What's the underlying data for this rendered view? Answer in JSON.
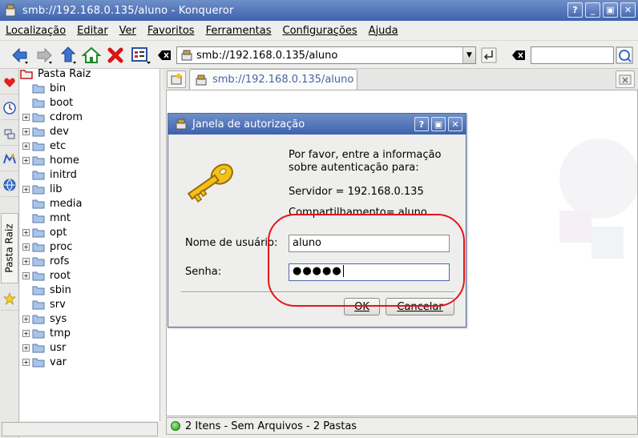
{
  "window": {
    "title": "smb://192.168.0.135/aluno - Konqueror",
    "buttons": [
      "?",
      "_",
      "▣",
      "✕"
    ]
  },
  "menu": {
    "items": [
      {
        "label": "Localização"
      },
      {
        "label": "Editar"
      },
      {
        "label": "Ver"
      },
      {
        "label": "Favoritos"
      },
      {
        "label": "Ferramentas"
      },
      {
        "label": "Configurações"
      },
      {
        "label": "Ajuda"
      }
    ]
  },
  "toolbar": {
    "url": "smb://192.168.0.135/aluno",
    "search_value": ""
  },
  "sidetabs": {
    "label": "Pasta Raiz"
  },
  "tree": {
    "root": "Pasta Raiz",
    "items": [
      {
        "label": "bin",
        "expandable": false
      },
      {
        "label": "boot",
        "expandable": false
      },
      {
        "label": "cdrom",
        "expandable": true
      },
      {
        "label": "dev",
        "expandable": true
      },
      {
        "label": "etc",
        "expandable": true
      },
      {
        "label": "home",
        "expandable": true
      },
      {
        "label": "initrd",
        "expandable": false
      },
      {
        "label": "lib",
        "expandable": true
      },
      {
        "label": "media",
        "expandable": false
      },
      {
        "label": "mnt",
        "expandable": false
      },
      {
        "label": "opt",
        "expandable": true
      },
      {
        "label": "proc",
        "expandable": true
      },
      {
        "label": "rofs",
        "expandable": true
      },
      {
        "label": "root",
        "expandable": true
      },
      {
        "label": "sbin",
        "expandable": false
      },
      {
        "label": "srv",
        "expandable": false
      },
      {
        "label": "sys",
        "expandable": true
      },
      {
        "label": "tmp",
        "expandable": true
      },
      {
        "label": "usr",
        "expandable": true
      },
      {
        "label": "var",
        "expandable": true
      }
    ]
  },
  "main": {
    "tab_label": "smb://192.168.0.135/aluno",
    "status": "2 Itens - Sem Arquivos - 2 Pastas"
  },
  "dialog": {
    "title": "Janela de autorização",
    "info": "Por favor, entre a informação sobre autenticação para:",
    "server": "Servidor = 192.168.0.135",
    "share": "Compartilhamento= aluno",
    "username_label": "Nome de usuário:",
    "username_value": "aluno",
    "password_label": "Senha:",
    "password_mask": "●●●●●",
    "ok_label": "OK",
    "cancel_label": "Cancelar"
  },
  "colors": {
    "titlebar": "#3e62ad",
    "annotation": "#e8131a",
    "tab_text": "#4864a8"
  }
}
